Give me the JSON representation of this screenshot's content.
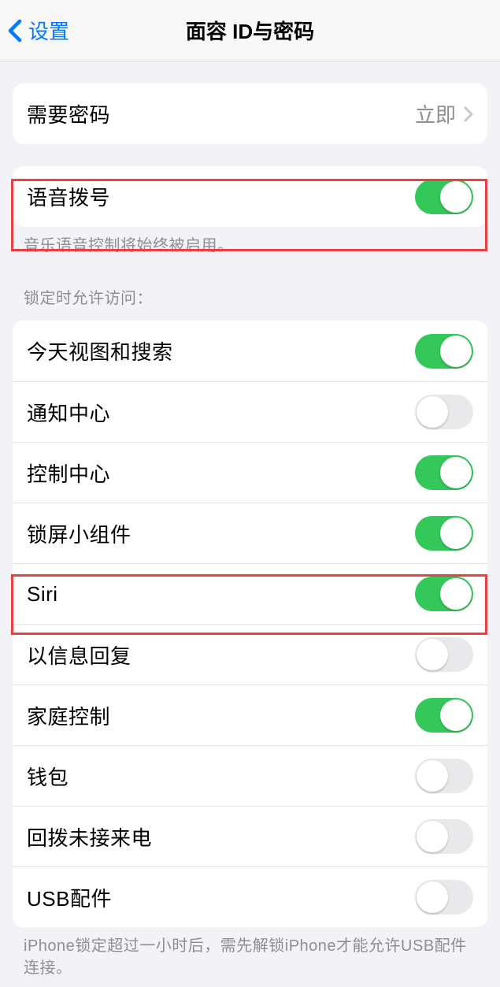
{
  "header": {
    "back_label": "设置",
    "title": "面容 ID与密码"
  },
  "passcode": {
    "label": "需要密码",
    "value": "立即"
  },
  "voice_dial": {
    "label": "语音拨号",
    "on": true,
    "footer": "音乐语音控制将始终被启用。"
  },
  "lock_access": {
    "header": "锁定时允许访问：",
    "items": [
      {
        "label": "今天视图和搜索",
        "on": true
      },
      {
        "label": "通知中心",
        "on": false
      },
      {
        "label": "控制中心",
        "on": true
      },
      {
        "label": "锁屏小组件",
        "on": true
      },
      {
        "label": "Siri",
        "on": true
      },
      {
        "label": "以信息回复",
        "on": false
      },
      {
        "label": "家庭控制",
        "on": true
      },
      {
        "label": "钱包",
        "on": false
      },
      {
        "label": "回拨未接来电",
        "on": false
      },
      {
        "label": "USB配件",
        "on": false
      }
    ],
    "footer": "iPhone锁定超过一小时后，需先解锁iPhone才能允许USB配件连接。"
  }
}
